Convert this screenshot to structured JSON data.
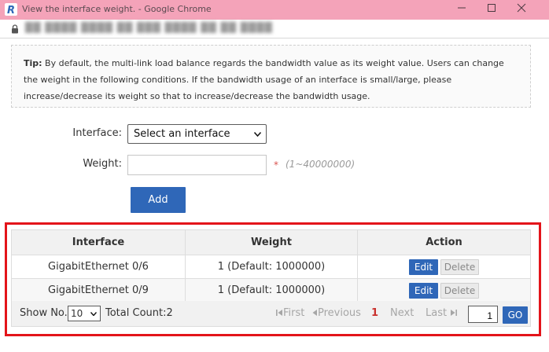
{
  "window": {
    "title": "View the interface weight. - Google Chrome",
    "colors": {
      "titlebar": "#f4a3b9",
      "accent": "#2f67b8",
      "highlight": "#e3141a"
    }
  },
  "addressbar": {
    "url": "██ ████ ████ ██ ███ ████ ██ ██ ████"
  },
  "tip": {
    "label": "Tip:",
    "text": "By default, the multi-link load balance regards the bandwidth value as its weight value. Users can change the weight in the following conditions. If the bandwidth usage of an interface is small/large, please increase/decrease its weight so that to increase/decrease the bandwidth usage."
  },
  "form": {
    "interface_label": "Interface:",
    "interface_value": "Select an interface",
    "weight_label": "Weight:",
    "weight_value": "",
    "required_mark": "*",
    "weight_range": "(1~40000000)",
    "add_label": "Add"
  },
  "table": {
    "headers": [
      "Interface",
      "Weight",
      "Action"
    ],
    "rows": [
      {
        "interface": "GigabitEthernet 0/6",
        "weight": "1  (Default: 1000000)",
        "edit": "Edit",
        "delete": "Delete"
      },
      {
        "interface": "GigabitEthernet 0/9",
        "weight": "1  (Default: 1000000)",
        "edit": "Edit",
        "delete": "Delete"
      }
    ]
  },
  "pager": {
    "show_label": "Show No.:",
    "page_size": "10",
    "total_count": "Total Count:2",
    "first": "First",
    "previous": "Previous",
    "current_page": "1",
    "next": "Next",
    "last": "Last",
    "page_input": "1",
    "go": "GO"
  }
}
